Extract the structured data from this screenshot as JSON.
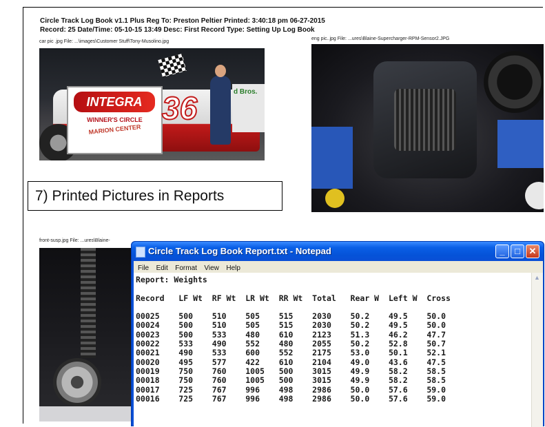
{
  "report_header": {
    "line1": "Circle Track Log Book v1.1 Plus   Reg To: Preston Peltier    Printed: 3:40:18 pm  06-27-2015",
    "line2": "Record: 25   Date/Time: 05-10-15 13:49    Desc: First Record    Type: Setting Up Log Book"
  },
  "pictures": {
    "car_caption": "car pic .jpg  File: ...\\images\\Customer Stuff\\Tony-Musolino.jpg",
    "eng_caption": "eng pic..jpg  File: ...ures\\Blaine-Supercharger-RPM-Sensor2.JPG",
    "susp_caption": "front-susp.jpg  File: ...ures\\Blaine-",
    "car_sign_logo": "INTEGRA",
    "car_sign_line1": "WINNER'S CIRCLE",
    "car_sign_line2": "MARION CENTER",
    "car_number": "36",
    "car_banner": "d Bros."
  },
  "label_box": "7) Printed Pictures in Reports",
  "notepad": {
    "title": "Circle Track Log Book Report.txt - Notepad",
    "menu": [
      "File",
      "Edit",
      "Format",
      "View",
      "Help"
    ],
    "report_title": "Report: Weights",
    "columns": [
      "Record",
      "LF Wt",
      "RF Wt",
      "LR Wt",
      "RR Wt",
      "Total",
      "Rear W",
      "Left W",
      "Cross"
    ],
    "rows": [
      [
        "00025",
        "500",
        "510",
        "505",
        "515",
        "2030",
        "50.2",
        "49.5",
        "50.0"
      ],
      [
        "00024",
        "500",
        "510",
        "505",
        "515",
        "2030",
        "50.2",
        "49.5",
        "50.0"
      ],
      [
        "00023",
        "500",
        "533",
        "480",
        "610",
        "2123",
        "51.3",
        "46.2",
        "47.7"
      ],
      [
        "00022",
        "533",
        "490",
        "552",
        "480",
        "2055",
        "50.2",
        "52.8",
        "50.7"
      ],
      [
        "00021",
        "490",
        "533",
        "600",
        "552",
        "2175",
        "53.0",
        "50.1",
        "52.1"
      ],
      [
        "00020",
        "495",
        "577",
        "422",
        "610",
        "2104",
        "49.0",
        "43.6",
        "47.5"
      ],
      [
        "00019",
        "750",
        "760",
        "1005",
        "500",
        "3015",
        "49.9",
        "58.2",
        "58.5"
      ],
      [
        "00018",
        "750",
        "760",
        "1005",
        "500",
        "3015",
        "49.9",
        "58.2",
        "58.5"
      ],
      [
        "00017",
        "725",
        "767",
        "996",
        "498",
        "2986",
        "50.0",
        "57.6",
        "59.0"
      ],
      [
        "00016",
        "725",
        "767",
        "996",
        "498",
        "2986",
        "50.0",
        "57.6",
        "59.0"
      ]
    ]
  }
}
